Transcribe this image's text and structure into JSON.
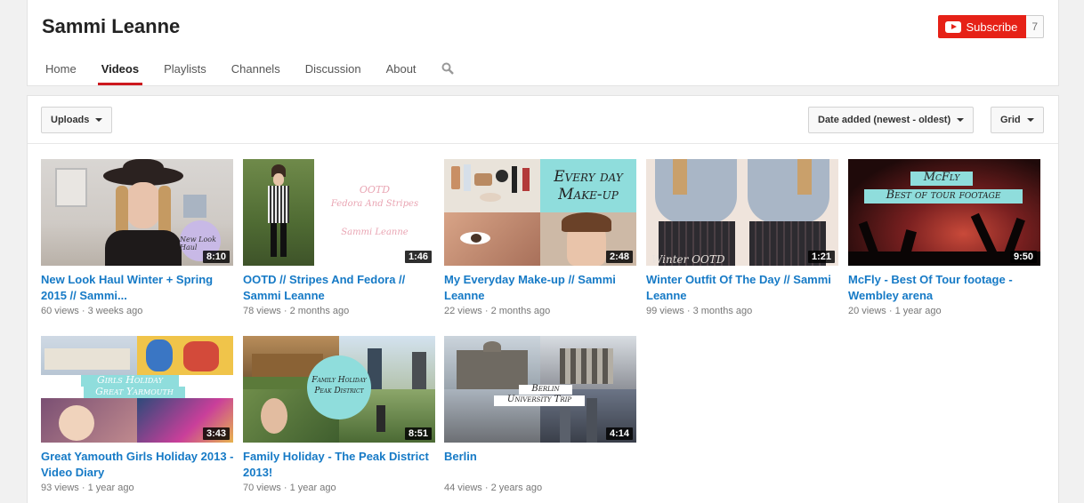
{
  "channel": {
    "name": "Sammi Leanne"
  },
  "subscribe": {
    "label": "Subscribe",
    "count": "7"
  },
  "tabs": [
    {
      "label": "Home",
      "active": false
    },
    {
      "label": "Videos",
      "active": true
    },
    {
      "label": "Playlists",
      "active": false
    },
    {
      "label": "Channels",
      "active": false
    },
    {
      "label": "Discussion",
      "active": false
    },
    {
      "label": "About",
      "active": false
    }
  ],
  "toolbar": {
    "uploads_label": "Uploads",
    "sort_label": "Date added (newest - oldest)",
    "view_label": "Grid"
  },
  "icons": {
    "search": "search-icon",
    "youtube": "youtube-logo-icon",
    "caret": "caret-down-icon"
  },
  "colors": {
    "accent": "#cc181e",
    "subscribe": "#e62117",
    "link": "#167ac6"
  },
  "videos": [
    {
      "title": "New Look Haul Winter + Spring 2015 // Sammi...",
      "views": "60 views",
      "age": "3 weeks ago",
      "duration": "8:10",
      "overlay": "New Look Haul"
    },
    {
      "title": "OOTD // Stripes And Fedora // Sammi Leanne",
      "views": "78 views",
      "age": "2 months ago",
      "duration": "1:46",
      "overlay": "OOTD",
      "overlay2": "Fedora And Stripes",
      "overlay3": "Sammi Leanne"
    },
    {
      "title": "My Everyday Make-up // Sammi Leanne",
      "views": "22 views",
      "age": "2 months ago",
      "duration": "2:48",
      "overlay": "Every day",
      "overlay2": "Make-up"
    },
    {
      "title": "Winter Outfit Of The Day // Sammi Leanne",
      "views": "99 views",
      "age": "3 months ago",
      "duration": "1:21",
      "overlay": "Winter OOTD"
    },
    {
      "title": "McFly - Best Of Tour footage - Wembley arena",
      "views": "20 views",
      "age": "1 year ago",
      "duration": "9:50",
      "overlay": "McFly",
      "overlay2": "Best of tour footage"
    },
    {
      "title": "Great Yamouth Girls Holiday 2013 - Video Diary",
      "views": "93 views",
      "age": "1 year ago",
      "duration": "3:43",
      "overlay": "Girls Holiday",
      "overlay2": "Great Yarmouth"
    },
    {
      "title": "Family Holiday - The Peak District 2013!",
      "views": "70 views",
      "age": "1 year ago",
      "duration": "8:51",
      "overlay": "Family Holiday",
      "overlay2": "Peak District"
    },
    {
      "title": "Berlin",
      "views": "44 views",
      "age": "2 years ago",
      "duration": "4:14",
      "overlay": "Berlin",
      "overlay2": "University Trip"
    }
  ]
}
